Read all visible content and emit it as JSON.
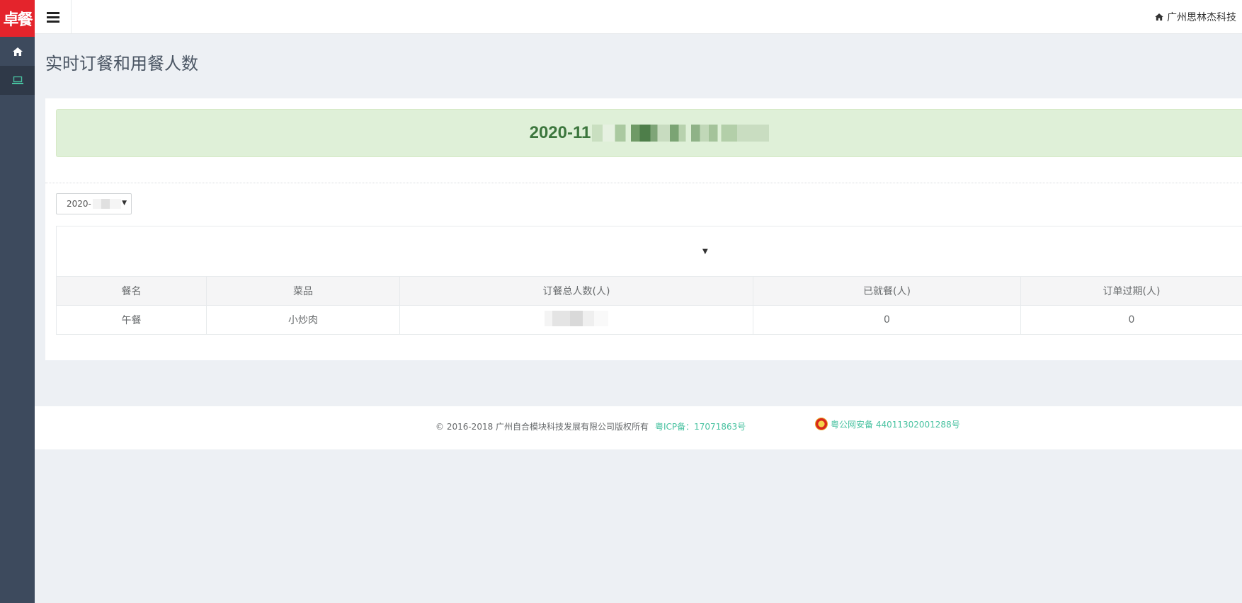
{
  "sidebar": {
    "logo_text": "卓餐",
    "items": [
      {
        "icon": "home-icon",
        "active": false
      },
      {
        "icon": "laptop-icon",
        "active": true
      }
    ]
  },
  "topbar": {
    "company": "广州思林杰科技"
  },
  "page": {
    "title": "实时订餐和用餐人数"
  },
  "alert": {
    "date_prefix": "2020-11"
  },
  "date_select": {
    "value_prefix": "2020-"
  },
  "table": {
    "headers": [
      "餐名",
      "菜品",
      "订餐总人数(人)",
      "已就餐(人)",
      "订单过期(人)"
    ],
    "rows": [
      {
        "meal": "午餐",
        "dish": "小炒肉",
        "total": "",
        "eaten": "0",
        "expired": "0"
      }
    ]
  },
  "footer": {
    "copyright": "© 2016-2018 广州自合模块科技发展有限公司版权所有",
    "icp": "粤ICP备：17071863号",
    "police": "粤公网安备 44011302001288号"
  },
  "colors": {
    "sidebar_bg": "#3d4a5d",
    "logo_bg": "#e4242c",
    "alert_bg": "#dff0d8",
    "alert_text": "#3c763d",
    "link": "#48c2a0"
  }
}
